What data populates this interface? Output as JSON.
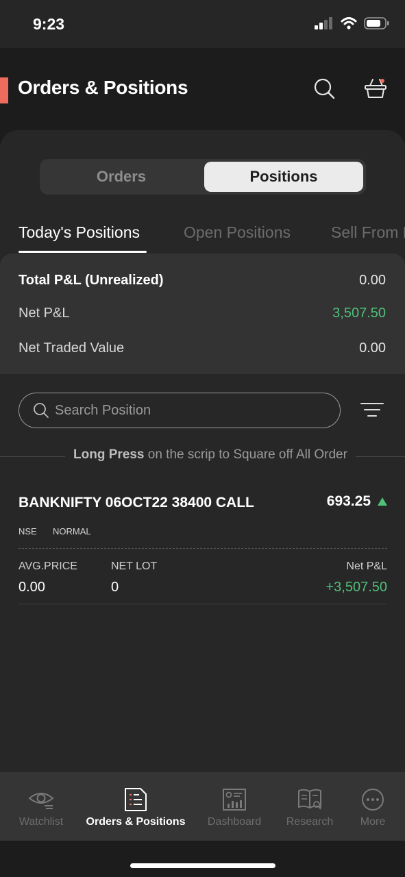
{
  "status_bar": {
    "time": "9:23"
  },
  "header": {
    "title": "Orders & Positions",
    "accent_color": "#ef6b5e"
  },
  "segment": {
    "orders_label": "Orders",
    "positions_label": "Positions",
    "selected": "Positions"
  },
  "subtabs": [
    {
      "label": "Today's Positions",
      "active": true
    },
    {
      "label": "Open Positions",
      "active": false
    },
    {
      "label": "Sell From Holdings",
      "active": false
    }
  ],
  "summary": {
    "total_pnl_label": "Total P&L (Unrealized)",
    "total_pnl_value": "0.00",
    "net_pnl_label": "Net P&L",
    "net_pnl_value": "3,507.50",
    "net_traded_label": "Net Traded Value",
    "net_traded_value": "0.00"
  },
  "search": {
    "placeholder": "Search Position",
    "value": ""
  },
  "hint": {
    "bold": "Long Press",
    "rest": "on the scrip to Square off All Order"
  },
  "positions": [
    {
      "symbol": "BANKNIFTY 06OCT22 38400 CALL",
      "ltp": "693.25",
      "exchange": "NSE",
      "product": "NORMAL",
      "avg_price_label": "AVG.PRICE",
      "avg_price": "0.00",
      "net_lot_label": "NET LOT",
      "net_lot": "0",
      "net_pnl_label": "Net P&L",
      "net_pnl": "+3,507.50"
    }
  ],
  "bottom_nav": [
    {
      "label": "Watchlist",
      "icon": "eye-icon",
      "active": false
    },
    {
      "label": "Orders & Positions",
      "icon": "orders-list-icon",
      "active": true
    },
    {
      "label": "Dashboard",
      "icon": "dashboard-icon",
      "active": false
    },
    {
      "label": "Research",
      "icon": "research-book-icon",
      "active": false
    },
    {
      "label": "More",
      "icon": "more-dots-icon",
      "active": false
    }
  ],
  "colors": {
    "positive": "#4fc17a",
    "background": "#272727",
    "accent": "#ef6b5e"
  }
}
